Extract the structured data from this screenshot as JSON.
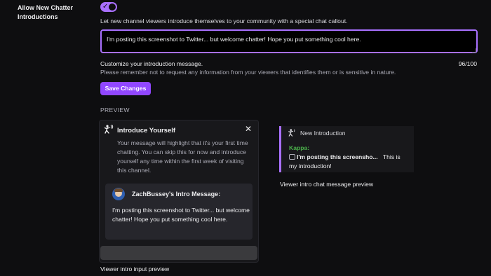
{
  "setting": {
    "label_line1": "Allow New Chatter",
    "label_line2": "Introductions",
    "toggle_on": true,
    "description": "Let new channel viewers introduce themselves to your community with a special chat callout."
  },
  "editor": {
    "value": "I'm posting this screenshot to Twitter... but welcome chatter! Hope you put something cool here.",
    "customize_label": "Customize your introduction message.",
    "char_count": "96/100",
    "privacy_note": "Please remember not to request any information from your viewers that identifies them or is sensitive in nature.",
    "save_label": "Save Changes"
  },
  "preview": {
    "section_label": "PREVIEW",
    "card": {
      "title": "Introduce Yourself",
      "close_glyph": "✕",
      "body": "Your message will highlight that it's your first time chatting. You can skip this for now and introduce yourself any time within the first week of visiting this channel.",
      "intro_name": "ZachBussey's Intro Message:",
      "intro_message": "I'm posting this screenshot to Twitter... but welcome chatter! Hope you put something cool here."
    },
    "input_caption": "Viewer intro input preview",
    "chat": {
      "header": "New Introduction",
      "username": "Kappa:",
      "line1_text": "I'm posting this screensho...",
      "line1_suffix": "This is",
      "line2": "my introduction!",
      "caption": "Viewer intro chat message preview"
    }
  },
  "colors": {
    "accent": "#a970ff",
    "button": "#9147ff",
    "username": "#4bb04b",
    "background": "#0e0e10"
  },
  "icons": [
    "checkmark-icon",
    "wave-hand-icon",
    "close-icon",
    "emote-icon"
  ]
}
